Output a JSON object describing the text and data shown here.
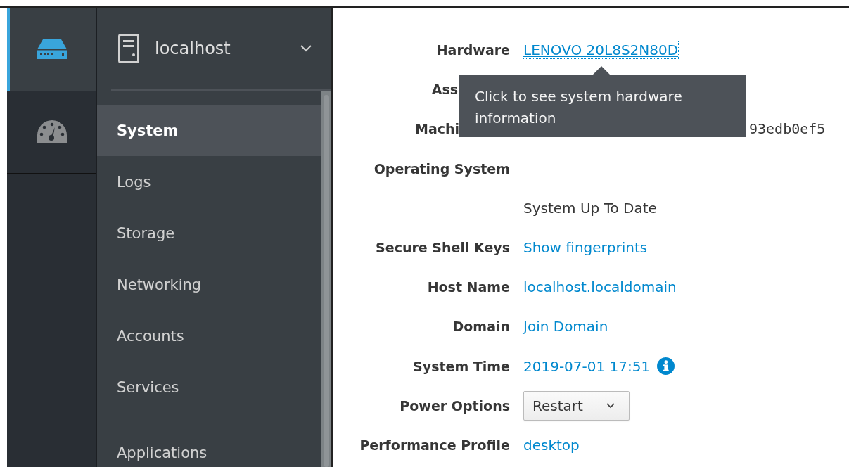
{
  "icon_rail": [
    {
      "kind": "server",
      "selected": true
    },
    {
      "kind": "dashboard",
      "selected": false
    }
  ],
  "host_switcher": {
    "label": "localhost",
    "expanded": false
  },
  "nav_groups": [
    [
      {
        "label": "System",
        "selected": true
      },
      {
        "label": "Logs",
        "selected": false
      },
      {
        "label": "Storage",
        "selected": false
      },
      {
        "label": "Networking",
        "selected": false
      },
      {
        "label": "Accounts",
        "selected": false
      },
      {
        "label": "Services",
        "selected": false
      }
    ],
    [
      {
        "label": "Applications",
        "selected": false
      }
    ]
  ],
  "details": [
    {
      "kind": "focused-link",
      "label": "Hardware",
      "value": "LENOVO 20L8S2N80D"
    },
    {
      "kind": "covered-label",
      "label": "Ass"
    },
    {
      "kind": "covered-mono",
      "label": "Machi",
      "value": "93edb0ef5"
    },
    {
      "kind": "heading",
      "label": "Operating System"
    },
    {
      "kind": "text",
      "value": "System Up To Date"
    },
    {
      "kind": "link",
      "label": "Secure Shell Keys",
      "value": "Show fingerprints"
    },
    {
      "kind": "link",
      "label": "Host Name",
      "value": "localhost.localdomain"
    },
    {
      "kind": "link",
      "label": "Domain",
      "value": "Join Domain"
    },
    {
      "kind": "time-link",
      "label": "System Time",
      "value": "2019-07-01 17:51"
    },
    {
      "kind": "split-button",
      "label": "Power Options",
      "value": "Restart"
    },
    {
      "kind": "link",
      "label": "Performance Profile",
      "value": "desktop"
    }
  ],
  "tooltip": {
    "text": "Click to see system hardware information"
  }
}
